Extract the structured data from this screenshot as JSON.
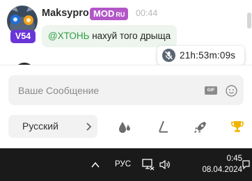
{
  "message": {
    "username": "Maksypro",
    "mod_badge": "MOD",
    "mod_region": "RU",
    "time": "00:44",
    "level": "V54",
    "mention": "@ХТОНЬ",
    "text": " нахуй того дрыща"
  },
  "mute": {
    "timer": "21h:53m:09s"
  },
  "input": {
    "placeholder": "Ваше Сообщение",
    "value": ""
  },
  "gif_label": "GIF",
  "language_select": {
    "selected": "Русский"
  },
  "toolbar": [
    "drops-icon",
    "slash-icon",
    "rocket-icon",
    "trophy-icon"
  ],
  "taskbar": {
    "language": "РУС",
    "time": "0:45",
    "date": "08.04.2024"
  },
  "colors": {
    "level_badge": "#6a35d8",
    "mod_badge": "#b256c8",
    "mention": "#2f9e44",
    "bubble": "#edf5ee",
    "trophy": "#f0b400",
    "taskbar": "#1a1a1a"
  }
}
